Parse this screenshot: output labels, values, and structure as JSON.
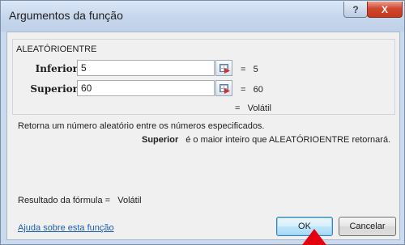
{
  "window": {
    "title": "Argumentos da função",
    "help_button": "?",
    "close_button": "X"
  },
  "function": {
    "name": "ALEATÓRIOENTRE",
    "args": [
      {
        "label": "Inferior",
        "value": "5",
        "equals": "=",
        "result": "5"
      },
      {
        "label": "Superior",
        "value": "60",
        "equals": "=",
        "result": "60"
      }
    ],
    "result_equals": "=",
    "result": "Volátil",
    "description": "Retorna um número aleatório entre os números especificados.",
    "param_name": "Superior",
    "param_description": "é o maior inteiro que ALEATÓRIOENTRE retornará."
  },
  "footer": {
    "formula_result_label": "Resultado da fórmula =",
    "formula_result_value": "Volátil",
    "help_link": "Ajuda sobre esta função",
    "ok_label": "OK",
    "cancel_label": "Cancelar"
  },
  "colors": {
    "title_bar": "#c5d6ec",
    "close_button": "#c33a20",
    "link": "#1a5fb4",
    "annotation_arrow": "#e3000f"
  },
  "icons": [
    "help-icon",
    "close-icon",
    "collapse-dialog-icon"
  ]
}
